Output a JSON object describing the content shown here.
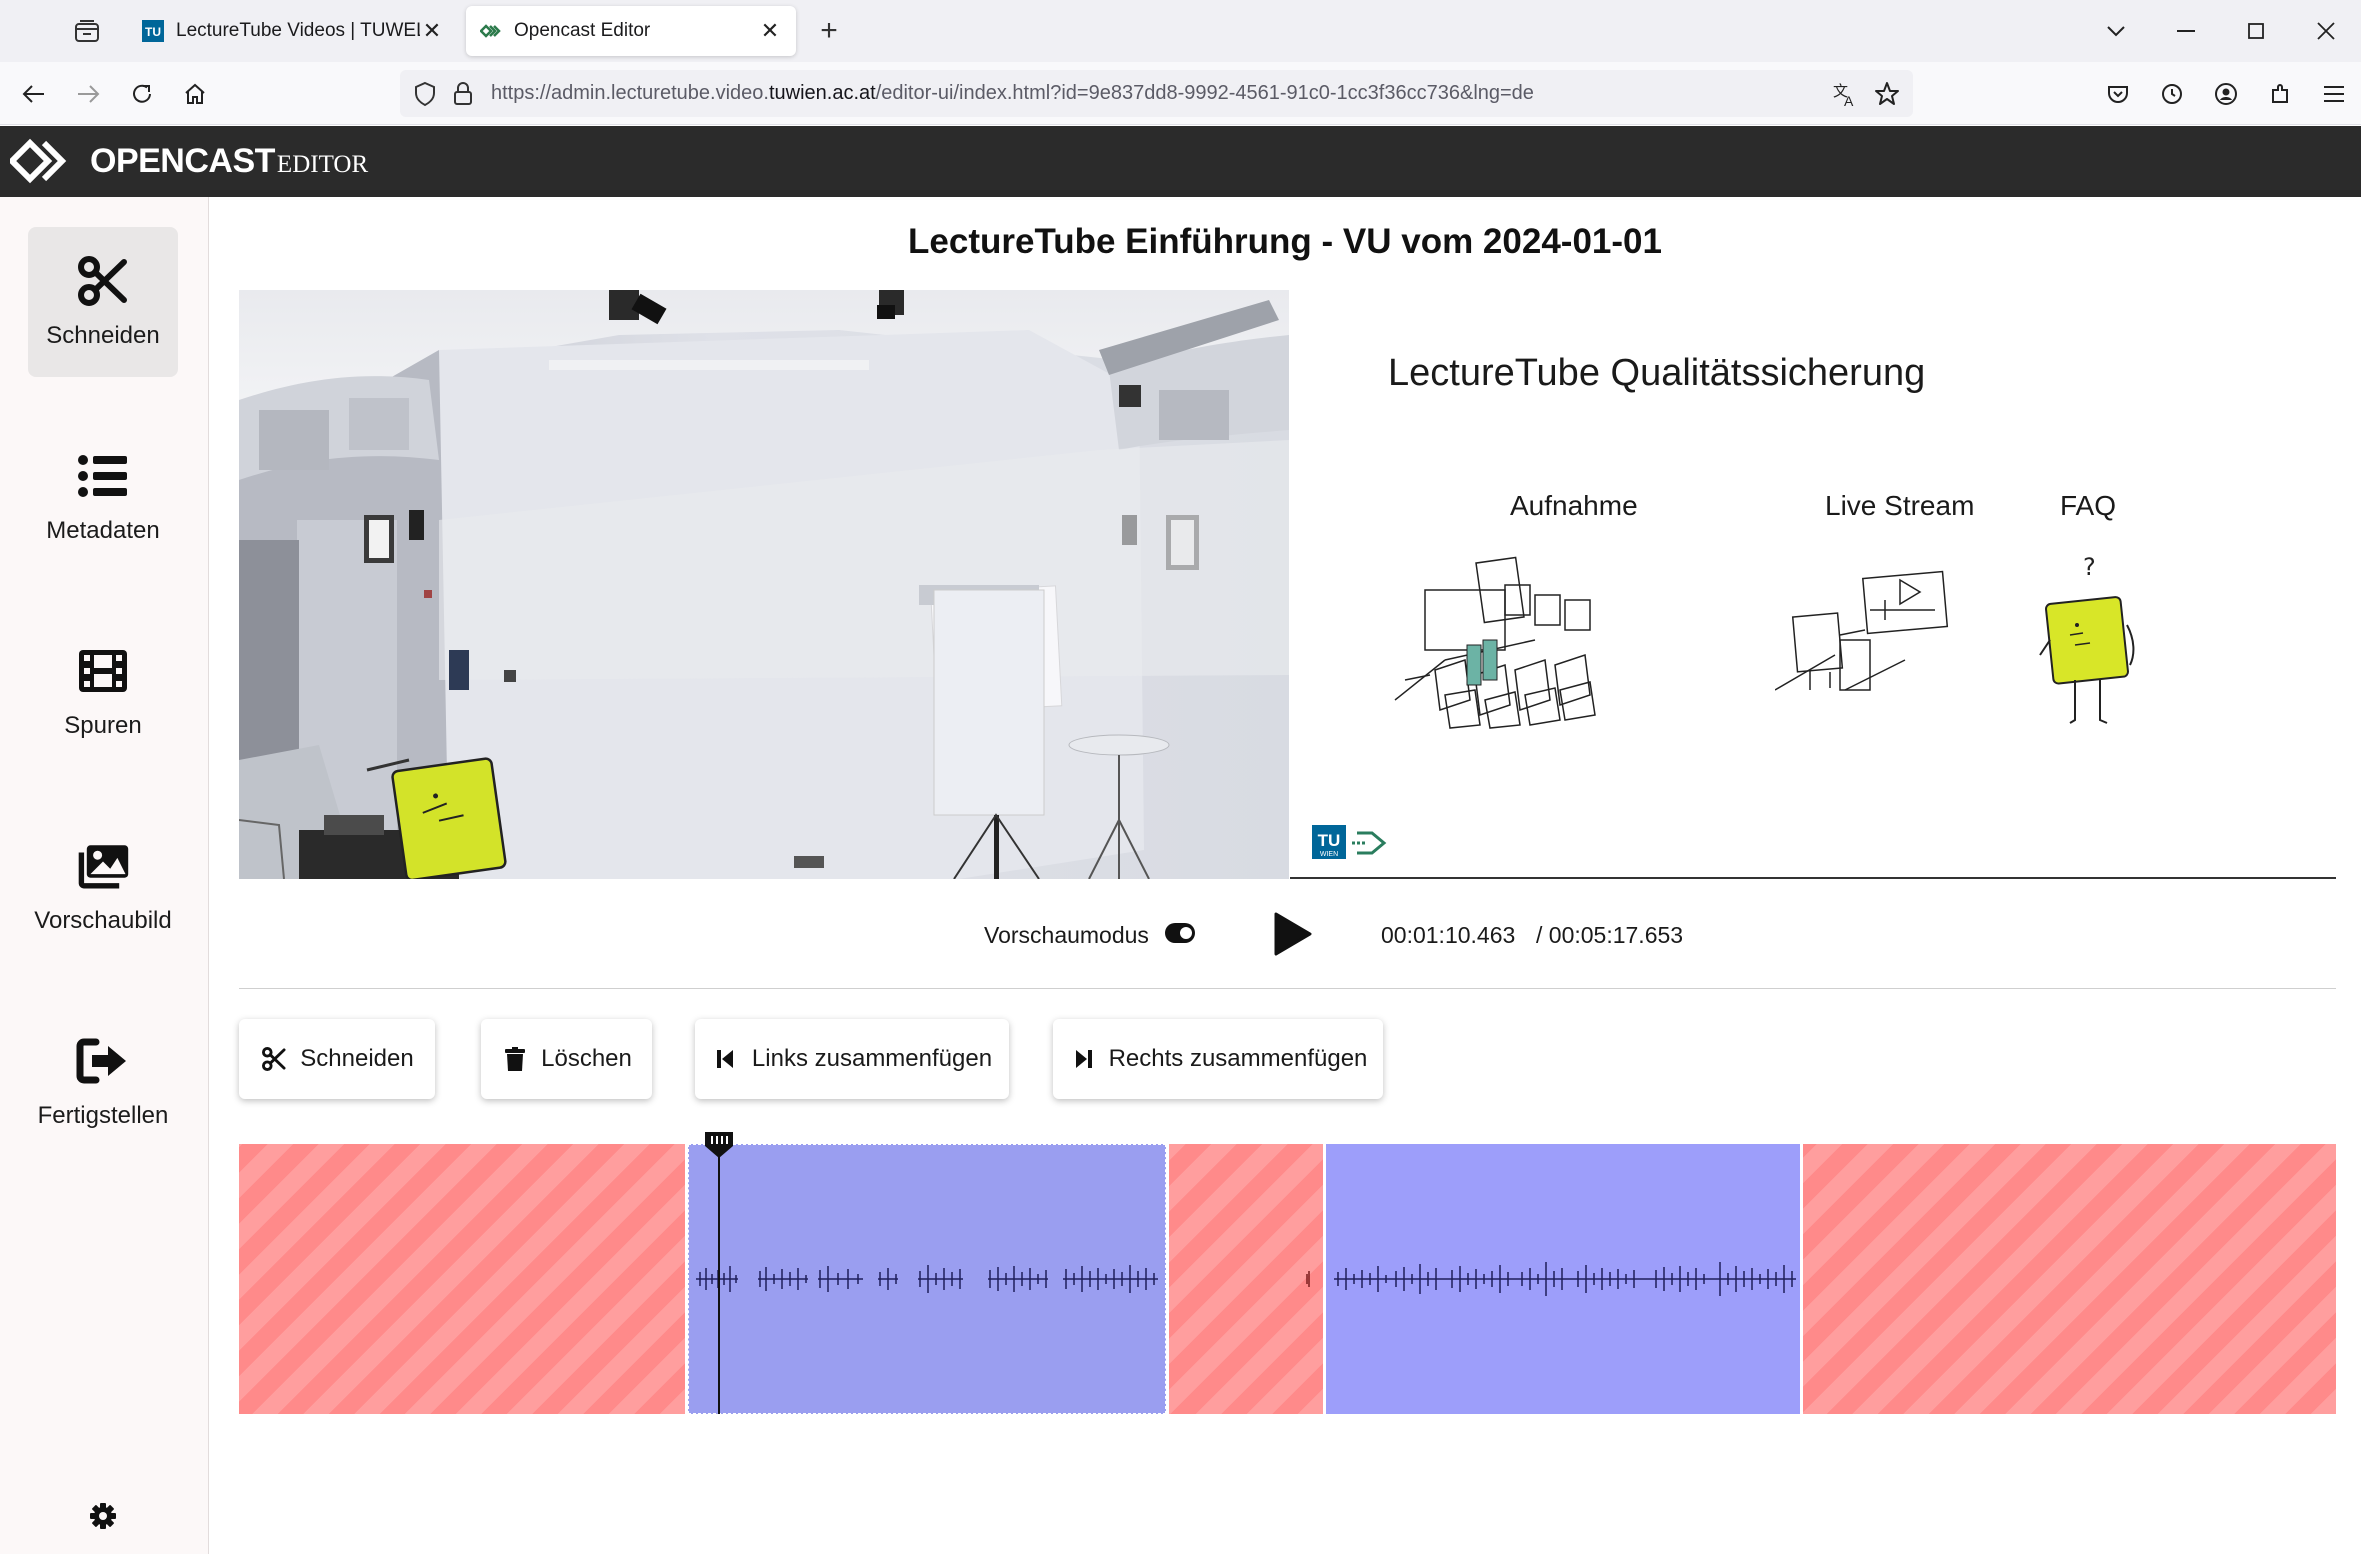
{
  "browser": {
    "tabs": [
      {
        "title": "LectureTube Videos | TUWEL",
        "favicon": "tu-icon"
      },
      {
        "title": "Opencast Editor",
        "favicon": "opencast-icon"
      }
    ],
    "url_prefix": "https://admin.lecturetube.video.",
    "url_domain": "tuwien.ac.at",
    "url_suffix": "/editor-ui/index.html?id=9e837dd8-9992-4561-91c0-1cc3f36cc736&lng=de"
  },
  "app": {
    "name": "OPENCAST",
    "sub": "EDITOR"
  },
  "sidebar": {
    "items": [
      {
        "label": "Schneiden",
        "icon": "scissors-icon"
      },
      {
        "label": "Metadaten",
        "icon": "list-icon"
      },
      {
        "label": "Spuren",
        "icon": "film-icon"
      },
      {
        "label": "Vorschaubild",
        "icon": "images-icon"
      },
      {
        "label": "Fertigstellen",
        "icon": "sign-out-icon"
      }
    ]
  },
  "main": {
    "title": "LectureTube Einführung - VU vom 2024-01-01",
    "slide": {
      "title": "LectureTube Qualitätssicherung",
      "labels": [
        "Aufnahme",
        "Live Stream",
        "FAQ"
      ]
    },
    "controls": {
      "preview_label": "Vorschaumodus",
      "time_current": "00:01:10.463",
      "time_total": "/ 00:05:17.653"
    },
    "toolbar": {
      "cut": "Schneiden",
      "delete": "Löschen",
      "merge_left": "Links zusammenfügen",
      "merge_right": "Rechts zusammenfügen"
    }
  }
}
